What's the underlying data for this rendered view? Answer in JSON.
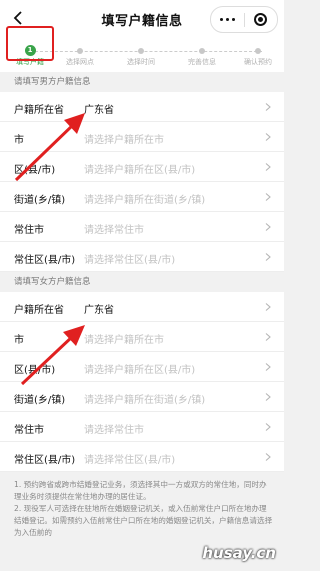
{
  "header": {
    "title": "填写户籍信息",
    "back_icon": "back-arrow-icon"
  },
  "steps": [
    {
      "num": "1",
      "label": "填写户籍"
    },
    {
      "label": "选择网点"
    },
    {
      "label": "选择时间"
    },
    {
      "label": "完善信息"
    },
    {
      "label": "确认预约"
    }
  ],
  "male": {
    "title": "请填写男方户籍信息",
    "rows": [
      {
        "label": "户籍所在省",
        "value": "广东省"
      },
      {
        "label": "市",
        "value": "请选择户籍所在市"
      },
      {
        "label": "区(县/市)",
        "value": "请选择户籍所在区(县/市)"
      },
      {
        "label": "街道(乡/镇)",
        "value": "请选择户籍所在街道(乡/镇)"
      },
      {
        "label": "常住市",
        "value": "请选择常住市"
      },
      {
        "label": "常住区(县/市)",
        "value": "请选择常住区(县/市)"
      }
    ]
  },
  "female": {
    "title": "请填写女方户籍信息",
    "rows": [
      {
        "label": "户籍所在省",
        "value": "广东省"
      },
      {
        "label": "市",
        "value": "请选择户籍所在市"
      },
      {
        "label": "区(县/市)",
        "value": "请选择户籍所在区(县/市)"
      },
      {
        "label": "街道(乡/镇)",
        "value": "请选择户籍所在街道(乡/镇)"
      },
      {
        "label": "常住市",
        "value": "请选择常住市"
      },
      {
        "label": "常住区(县/市)",
        "value": "请选择常住区(县/市)"
      }
    ]
  },
  "notes": [
    "1. 预约跨省或跨市结婚登记业务，须选择其中一方或双方的常住地，同时办理业务时须提供在常住地办理的居住证。",
    "2. 现役军人可选择在驻地所在婚姻登记机关，或入伍前常住户口所在地办理结婚登记。如需预约入伍前常住户口所在地的婚姻登记机关，户籍信息请选择为入伍前的"
  ],
  "watermark": "husay.cn",
  "colors": {
    "accent": "#3aa44a",
    "highlight": "#e02020"
  }
}
